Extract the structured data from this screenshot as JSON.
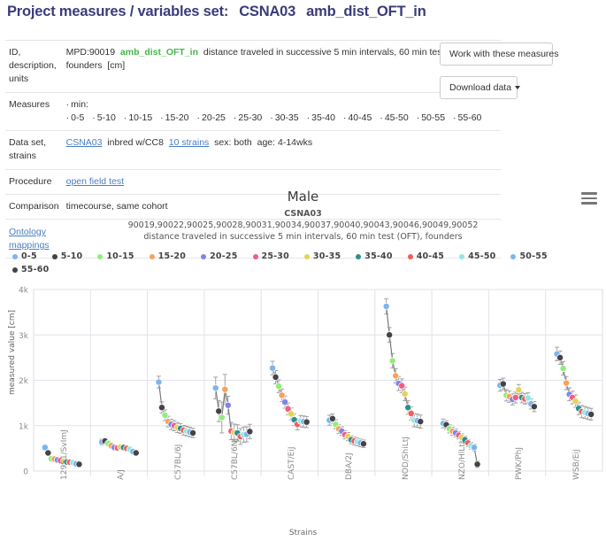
{
  "page_title": {
    "prefix": "Project measures / variables set:",
    "project": "CSNA03",
    "variable": "amb_dist_OFT_in"
  },
  "info_table": {
    "rows": [
      {
        "label": "ID, description, units",
        "id": "MPD:90019",
        "var_name": "amb_dist_OFT_in",
        "description": "distance traveled in successive 5 min intervals, 60 min test (OFT), founders",
        "units": "[cm]"
      },
      {
        "label": "Measures",
        "prefix": "min:",
        "items": [
          "0-5",
          "5-10",
          "10-15",
          "15-20",
          "20-25",
          "25-30",
          "30-35",
          "35-40",
          "40-45",
          "45-50",
          "50-55",
          "55-60"
        ]
      },
      {
        "label": "Data set, strains",
        "dataset": "CSNA03",
        "panel": "inbred w/CC8",
        "strains_link": "10 strains",
        "sex": "sex: both",
        "age": "age: 4-14wks"
      },
      {
        "label": "Procedure",
        "value": "open field test"
      },
      {
        "label": "Comparison",
        "value": "timecourse, same cohort"
      }
    ],
    "ontology_link": "Ontology mappings"
  },
  "buttons": {
    "work_with": "Work with these measures",
    "download": "Download data"
  },
  "chart_data": {
    "type": "scatter",
    "title": "Male",
    "subtitle_1": "CSNA03",
    "subtitle_2": "90019,90022,90025,90028,90031,90034,90037,90040,90043,90046,90049,90052",
    "subtitle_3": "distance traveled in successive 5 min intervals, 60 min test (OFT), founders",
    "xlabel": "Strains",
    "ylabel": "measured value [cm]",
    "ylim": [
      0,
      4000
    ],
    "yticks": [
      0,
      1000,
      2000,
      3000,
      4000
    ],
    "ytick_labels": [
      "0",
      "1k",
      "2k",
      "3k",
      "4k"
    ],
    "grid": true,
    "legend_position": "top",
    "categories": [
      "129S1/SvImJ",
      "A/J",
      "C57BL/6J",
      "C57BL/6NJ",
      "CAST/EiJ",
      "DBA/2J",
      "NOD/ShiLtJ",
      "NZO/HlLtJ",
      "PWK/PhJ",
      "WSB/EiJ"
    ],
    "series": [
      {
        "name": "0-5",
        "color": "#7cb5ec",
        "values": [
          520,
          640,
          1960,
          1830,
          2270,
          1120,
          3630,
          1050,
          1890,
          2580
        ]
      },
      {
        "name": "5-10",
        "color": "#434348",
        "values": [
          400,
          660,
          1400,
          1320,
          2070,
          1155,
          3000,
          1020,
          1920,
          2500
        ]
      },
      {
        "name": "10-15",
        "color": "#90ed7d",
        "values": [
          270,
          610,
          1230,
          1180,
          1870,
          1030,
          2430,
          930,
          1670,
          2260
        ]
      },
      {
        "name": "15-20",
        "color": "#f7a35c",
        "values": [
          265,
          560,
          1090,
          1800,
          1670,
          930,
          2100,
          880,
          1640,
          1940
        ]
      },
      {
        "name": "20-25",
        "color": "#8085e9",
        "values": [
          245,
          520,
          1030,
          1450,
          1520,
          880,
          1930,
          840,
          1580,
          1690
        ]
      },
      {
        "name": "25-30",
        "color": "#f15c80",
        "values": [
          230,
          510,
          1000,
          880,
          1370,
          800,
          1880,
          790,
          1620,
          1620
        ]
      },
      {
        "name": "30-35",
        "color": "#e4d354",
        "values": [
          215,
          530,
          960,
          850,
          1260,
          760,
          1700,
          740,
          1790,
          1540
        ]
      },
      {
        "name": "35-40",
        "color": "#2b908f",
        "values": [
          200,
          520,
          940,
          840,
          1130,
          690,
          1400,
          690,
          1620,
          1380
        ]
      },
      {
        "name": "40-45",
        "color": "#f45b5b",
        "values": [
          195,
          500,
          900,
          760,
          1030,
          660,
          1270,
          620,
          1590,
          1310
        ]
      },
      {
        "name": "45-50",
        "color": "#91e8e1",
        "values": [
          185,
          480,
          880,
          800,
          1100,
          640,
          1120,
          560,
          1610,
          1290
        ]
      },
      {
        "name": "50-55",
        "color": "#7cb5ec",
        "values": [
          160,
          430,
          860,
          810,
          1090,
          620,
          1110,
          520,
          1480,
          1270
        ]
      },
      {
        "name": "55-60",
        "color": "#434348",
        "values": [
          150,
          400,
          840,
          870,
          1080,
          600,
          1090,
          150,
          1420,
          1250
        ]
      }
    ],
    "errors": [
      [
        60,
        55,
        50,
        48,
        45,
        42,
        40,
        38,
        36,
        35,
        34,
        33
      ],
      [
        70,
        65,
        60,
        58,
        55,
        52,
        50,
        48,
        46,
        45,
        44,
        43
      ],
      [
        130,
        125,
        120,
        118,
        115,
        112,
        110,
        108,
        106,
        105,
        104,
        103
      ],
      [
        240,
        230,
        340,
        330,
        200,
        190,
        185,
        180,
        175,
        170,
        165,
        160
      ],
      [
        150,
        145,
        140,
        138,
        135,
        132,
        130,
        128,
        126,
        125,
        124,
        123
      ],
      [
        110,
        105,
        100,
        98,
        95,
        92,
        90,
        88,
        86,
        85,
        84,
        83
      ],
      [
        170,
        165,
        160,
        158,
        155,
        152,
        150,
        148,
        146,
        145,
        144,
        143
      ],
      [
        95,
        92,
        90,
        88,
        85,
        82,
        80,
        78,
        76,
        75,
        74,
        73
      ],
      [
        130,
        128,
        126,
        124,
        122,
        120,
        118,
        116,
        114,
        113,
        112,
        111
      ],
      [
        150,
        148,
        146,
        144,
        142,
        140,
        138,
        136,
        134,
        133,
        132,
        131
      ]
    ]
  }
}
